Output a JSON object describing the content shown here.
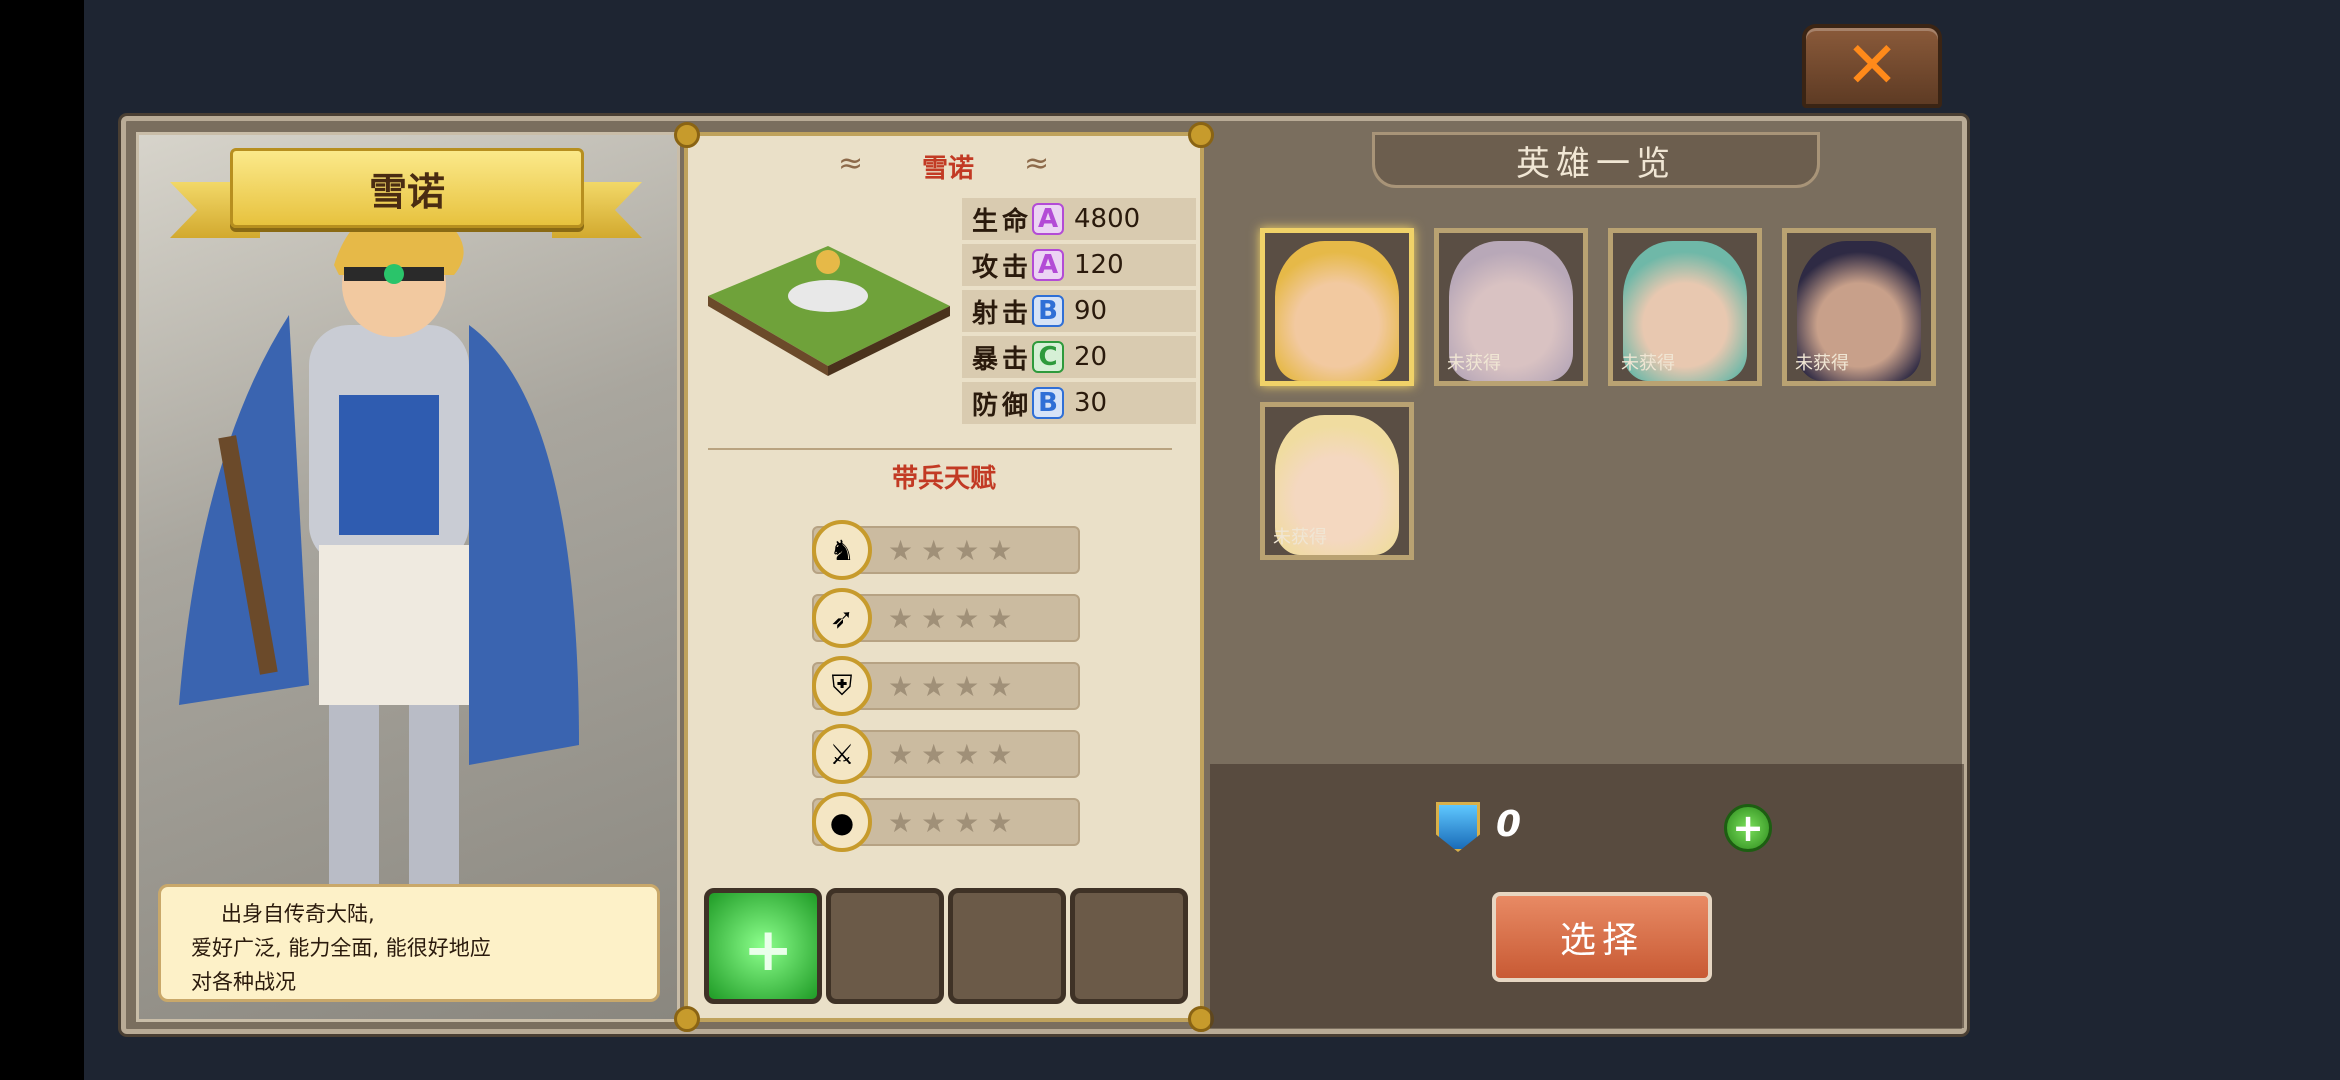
{
  "close": {
    "icon": "close-icon",
    "glyph": "✕"
  },
  "hero": {
    "name": "雪诺",
    "description": [
      "出身自传奇大陆,",
      "爱好广泛, 能力全面, 能很好地应",
      "对各种战况"
    ]
  },
  "stats": [
    {
      "label": "生命",
      "grade": "A",
      "value": "4800"
    },
    {
      "label": "攻击",
      "grade": "A",
      "value": "120"
    },
    {
      "label": "射击",
      "grade": "B",
      "value": "90"
    },
    {
      "label": "暴击",
      "grade": "C",
      "value": "20"
    },
    {
      "label": "防御",
      "grade": "B",
      "value": "30"
    }
  ],
  "talent": {
    "title": "带兵天赋",
    "rows": [
      {
        "icon": "horse-icon",
        "stars": "★★★★"
      },
      {
        "icon": "bow-icon",
        "stars": "★★★★"
      },
      {
        "icon": "shield-icon",
        "stars": "★★★★"
      },
      {
        "icon": "sword-icon",
        "stars": "★★★★"
      },
      {
        "icon": "bomb-icon",
        "stars": "★★★★"
      }
    ]
  },
  "roster": {
    "title": "英雄一览",
    "heroes": [
      {
        "status": "",
        "selected": true
      },
      {
        "status": "未获得",
        "selected": false
      },
      {
        "status": "未获得",
        "selected": false
      },
      {
        "status": "未获得",
        "selected": false
      },
      {
        "status": "未获得",
        "selected": false
      }
    ]
  },
  "currency": {
    "count": "0",
    "plus": "+"
  },
  "select_label": "选择"
}
